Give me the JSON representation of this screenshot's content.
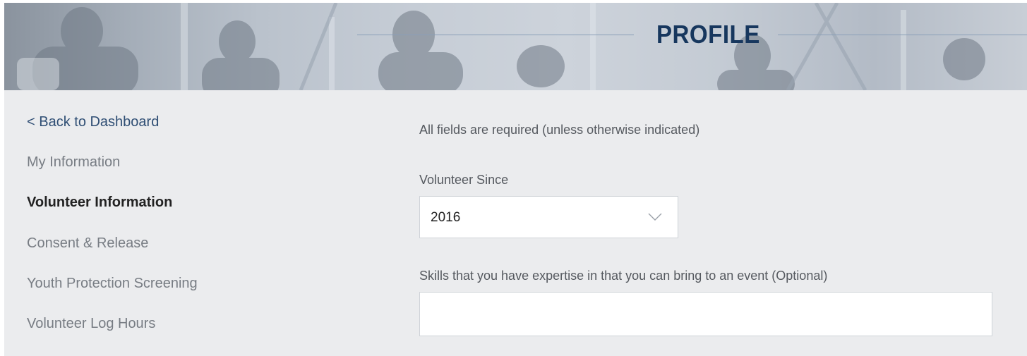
{
  "header": {
    "title": "PROFILE",
    "banner": "crowd-photo-banner"
  },
  "sidebar": {
    "back_link": "< Back to Dashboard",
    "items": [
      {
        "label": "My Information",
        "active": false
      },
      {
        "label": "Volunteer Information",
        "active": true
      },
      {
        "label": "Consent & Release",
        "active": false
      },
      {
        "label": "Youth Protection Screening",
        "active": false
      },
      {
        "label": "Volunteer Log Hours",
        "active": false
      }
    ]
  },
  "form": {
    "required_note": "All fields are required (unless otherwise indicated)",
    "volunteer_since": {
      "label": "Volunteer Since",
      "value": "2016",
      "icon": "chevron-down-icon"
    },
    "skills": {
      "label": "Skills that you have expertise in that you can bring to an event (Optional)",
      "value": "",
      "placeholder": ""
    }
  },
  "colors": {
    "page_bg": "#ebecee",
    "title": "#17375e",
    "link": "#2f4e74",
    "muted_text": "#777c83"
  }
}
